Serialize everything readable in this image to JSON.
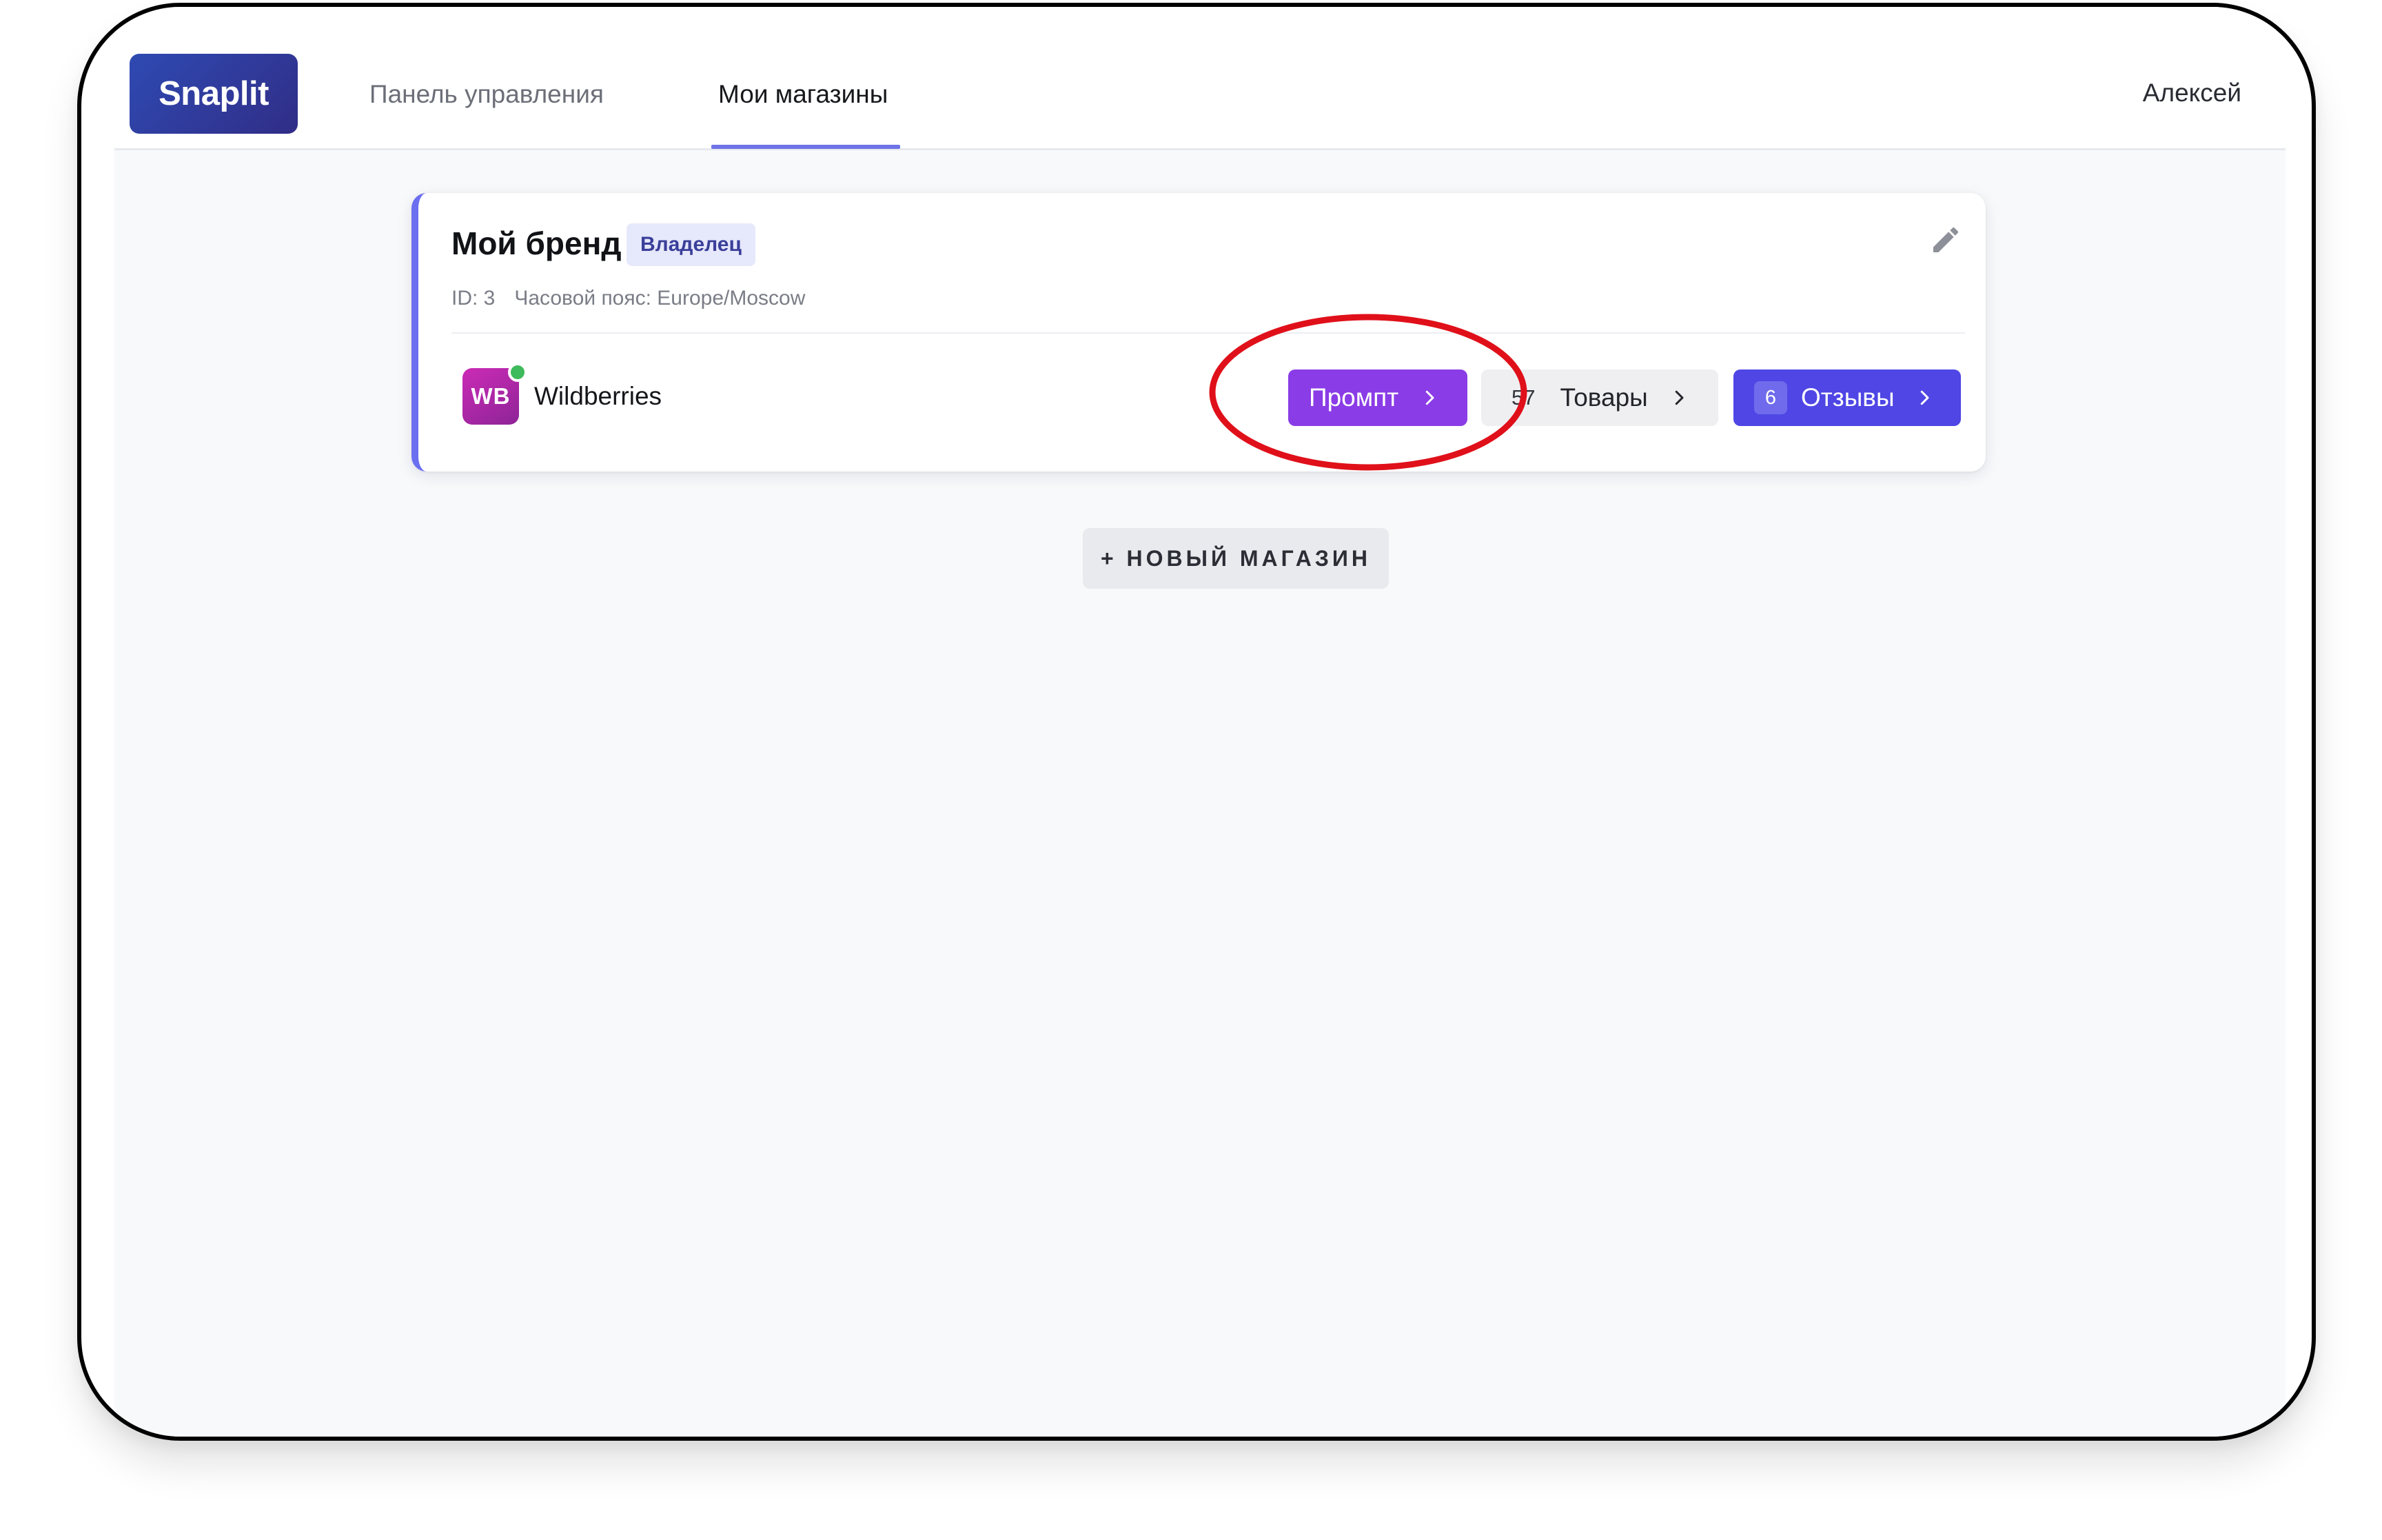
{
  "app": {
    "logo_text": "Snaplit",
    "brand_gradient": [
      "#2f4ab3",
      "#302d86"
    ]
  },
  "nav": {
    "items": [
      {
        "label": "Панель управления",
        "active": false
      },
      {
        "label": "Мои магазины",
        "active": true
      }
    ],
    "user_name": "Алексей"
  },
  "store": {
    "name": "Мой бренд",
    "role": "Владелец",
    "id_label": "ID: 3",
    "timezone_label": "Часовой пояс: Europe/Moscow",
    "edit_icon": "pencil-icon",
    "marketplace": {
      "logo_text": "WB",
      "name": "Wildberries",
      "status": "connected",
      "status_color": "#3fba5c"
    },
    "actions": {
      "prompt": {
        "label": "Промпт",
        "icon": "chevron-right-icon",
        "color": "#8a3ce6"
      },
      "products": {
        "count": "57",
        "label": "Товары",
        "icon": "chevron-right-icon"
      },
      "reviews": {
        "count": "6",
        "label": "Отзывы",
        "icon": "chevron-right-icon",
        "color": "#4f46e5"
      }
    }
  },
  "new_store_button": "+ НОВЫЙ МАГАЗИН",
  "annotation": {
    "color": "#e0101a",
    "target": "prompt-button"
  }
}
